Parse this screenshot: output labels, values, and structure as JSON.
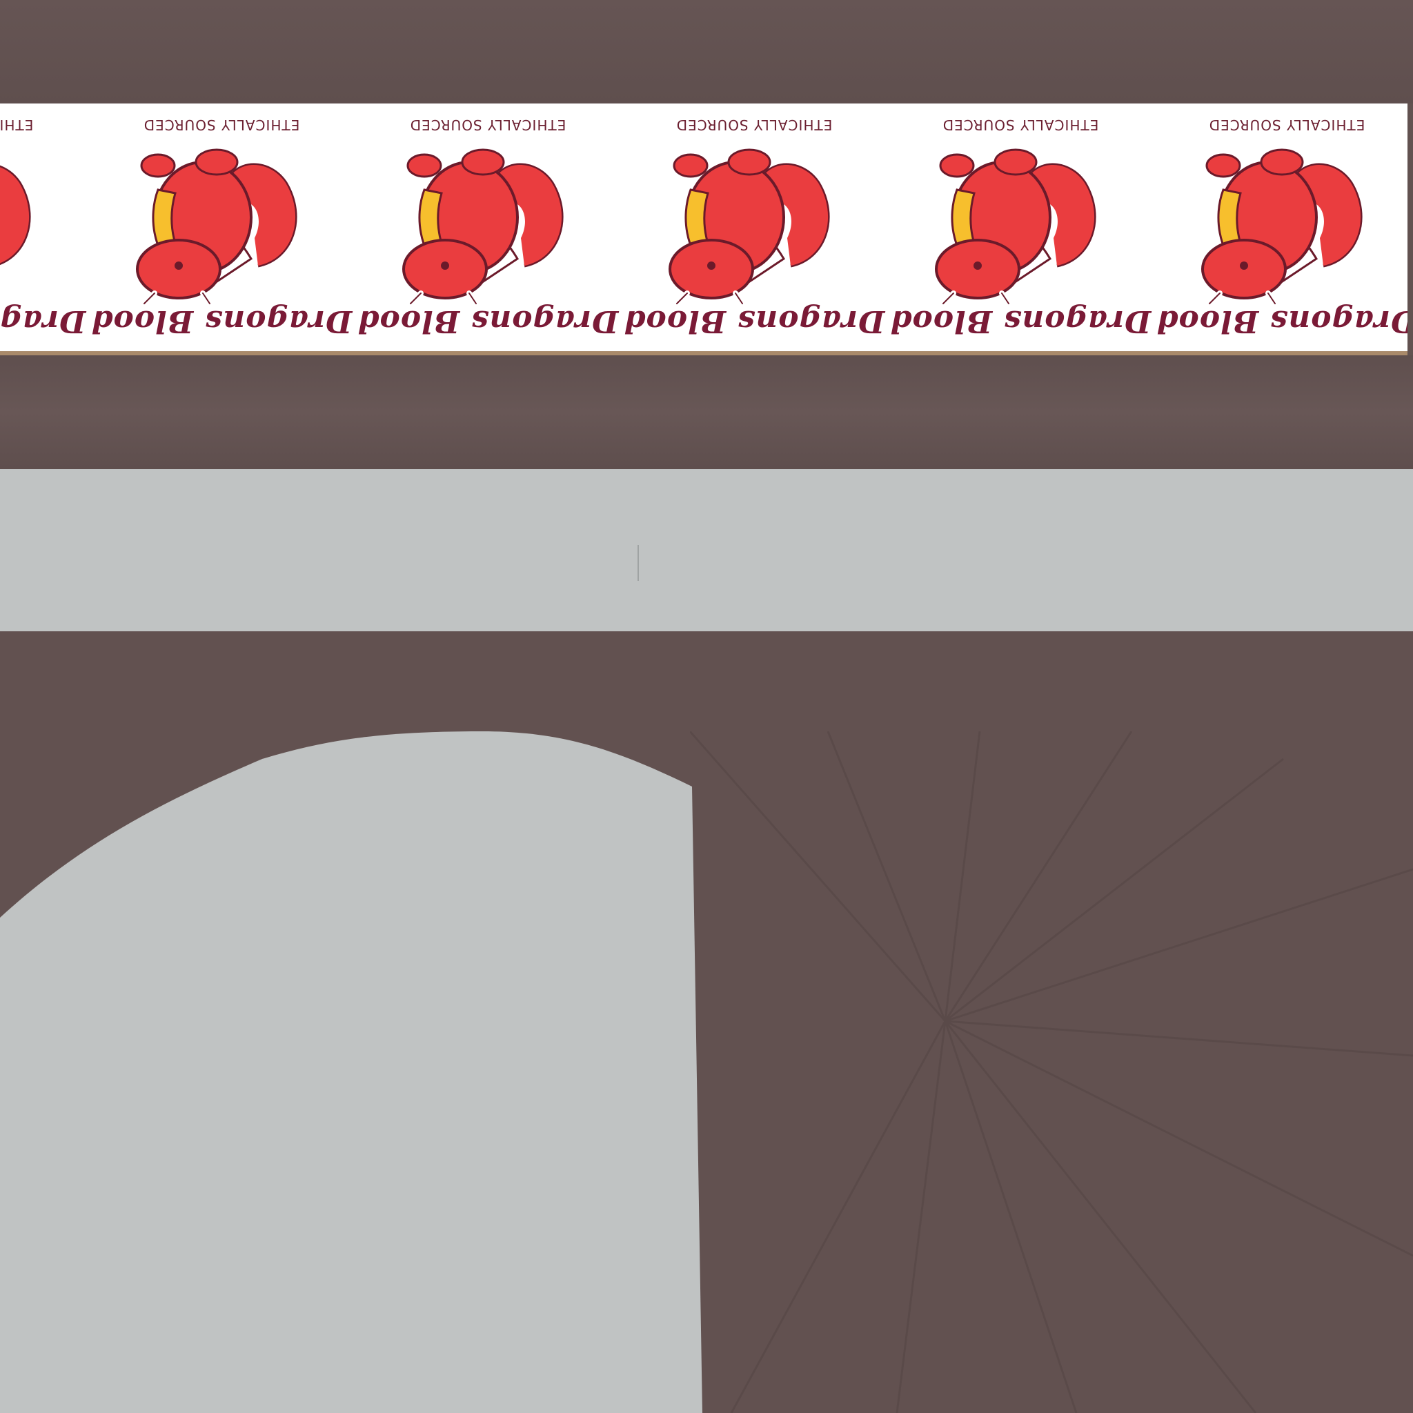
{
  "label": {
    "brand_text": "Dragons Blood",
    "tagline": "ETHICALLY SOURCED",
    "colors": {
      "background": "#ffffff",
      "text": "#7a1a36",
      "dragon_body": "#ea3d3f",
      "dragon_belly": "#f7bf2d",
      "outline": "#6b1a2a"
    }
  },
  "surfaces": {
    "dark": "#625250",
    "grey": "#c0c3c3"
  }
}
